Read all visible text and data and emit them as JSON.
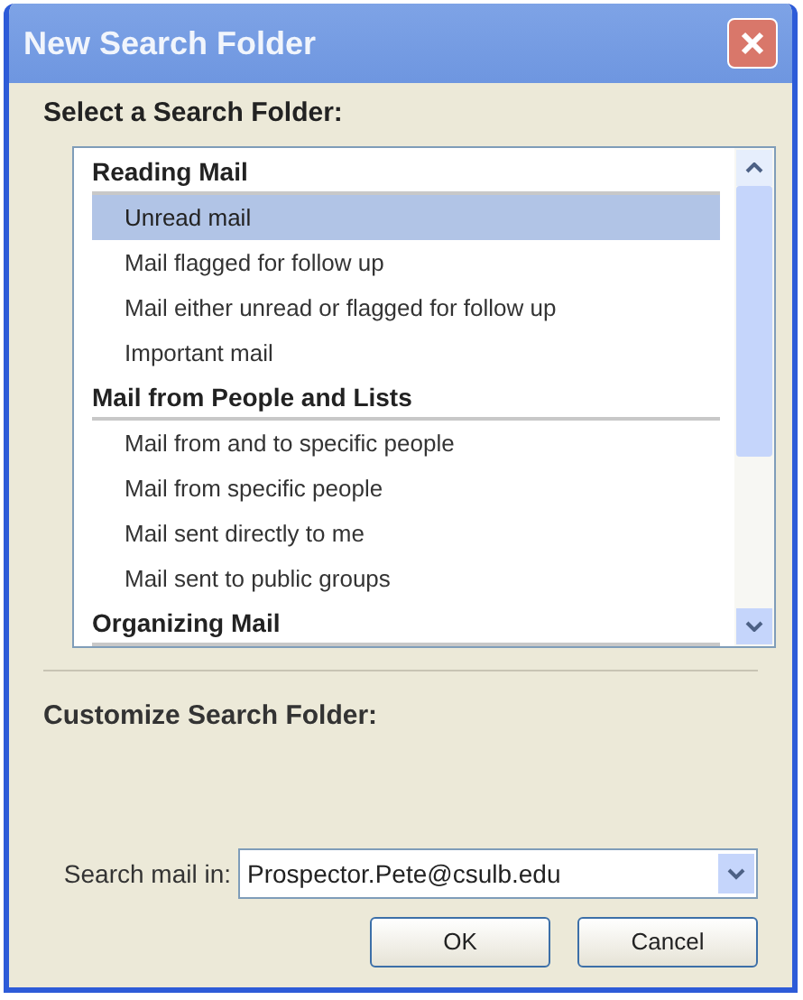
{
  "window": {
    "title": "New Search Folder"
  },
  "select_label": "Select a Search Folder:",
  "groups": [
    {
      "header": "Reading Mail",
      "items": [
        {
          "label": "Unread mail",
          "selected": true
        },
        {
          "label": "Mail flagged for follow up",
          "selected": false
        },
        {
          "label": "Mail either unread or flagged for follow up",
          "selected": false
        },
        {
          "label": "Important mail",
          "selected": false
        }
      ]
    },
    {
      "header": "Mail from People and Lists",
      "items": [
        {
          "label": "Mail from and to specific people",
          "selected": false
        },
        {
          "label": "Mail from specific people",
          "selected": false
        },
        {
          "label": "Mail sent directly to me",
          "selected": false
        },
        {
          "label": "Mail sent to public groups",
          "selected": false
        }
      ]
    },
    {
      "header": "Organizing Mail"
    }
  ],
  "customize_label": "Customize Search Folder:",
  "search_in": {
    "label": "Search mail in:",
    "value": "Prospector.Pete@csulb.edu"
  },
  "buttons": [
    "OK",
    "Cancel"
  ]
}
